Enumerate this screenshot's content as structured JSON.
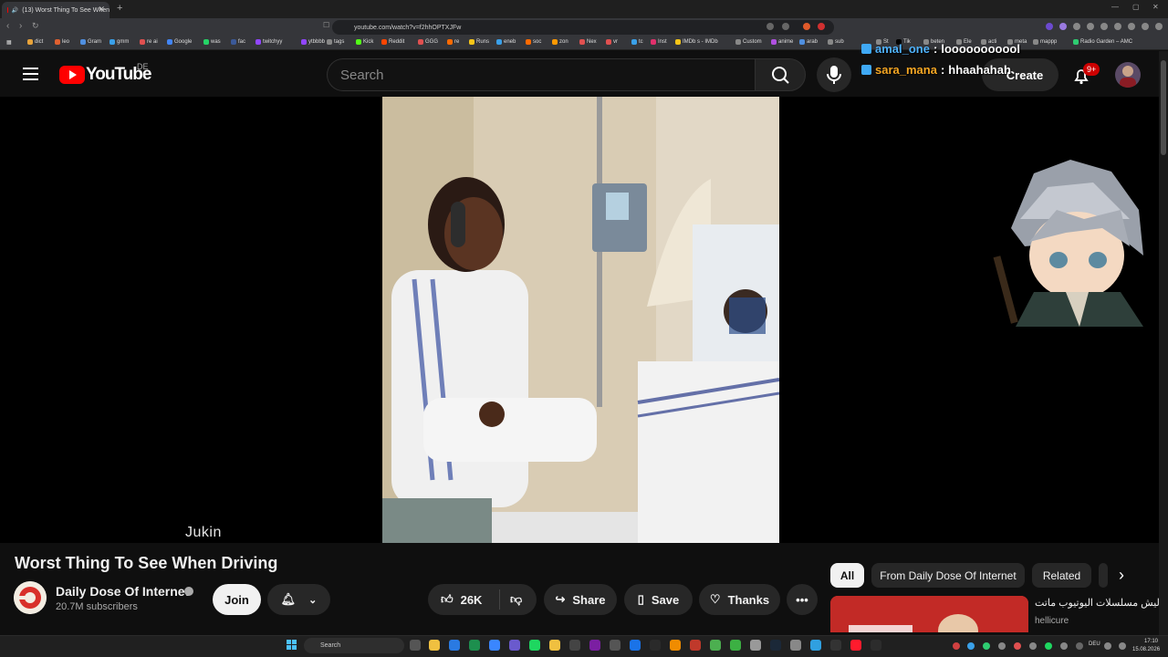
{
  "browser": {
    "tab_title": "(13) Worst Thing To See When",
    "url": "youtube.com/watch?v=f2hhOPTXJFw",
    "bookmarks": [
      "dict",
      "leo",
      "Gram",
      "gmm",
      "re ai",
      "Google",
      "was",
      "fac",
      "twitchyy",
      "ytbbbb",
      "tags",
      "Kick",
      "Reddit",
      "GGG",
      "re",
      "Runs",
      "eneb",
      "soc",
      "zon",
      "Nex",
      "vr",
      "tc",
      "Inst",
      "IMDb s - IMDb",
      "Custom",
      "anime",
      "arab",
      "sub",
      "St",
      "Tik",
      "beten",
      "Ele",
      "acti",
      "meta",
      "mappp",
      "Radio Garden – AMC"
    ]
  },
  "youtube": {
    "logo_text": "YouTube",
    "region": "DE",
    "search_placeholder": "Search",
    "create_label": "Create",
    "notifications_badge": "9+"
  },
  "chat_overlay": [
    {
      "user": "amal_one",
      "message": "looooooooool"
    },
    {
      "user": "sara_mana",
      "message": "hhaahahah"
    }
  ],
  "video": {
    "watermark": "Jukin",
    "title": "Worst Thing To See When Driving"
  },
  "channel": {
    "name": "Daily Dose Of Internet",
    "subscribers": "20.7M subscribers",
    "join_label": "Join"
  },
  "actions": {
    "likes": "26K",
    "share": "Share",
    "save": "Save",
    "thanks": "Thanks"
  },
  "chips": [
    "All",
    "From Daily Dose Of Internet",
    "Related"
  ],
  "related": {
    "title": "ليش مسلسلات اليوتيوب ماتت",
    "channel": "hellicure"
  },
  "taskbar": {
    "search": "Search",
    "lang": "DEU",
    "time": "17:10",
    "date": "15.08.2026"
  },
  "colors": {
    "accent_red": "#ff0000",
    "background": "#0f0f0f",
    "chip": "#272727"
  }
}
